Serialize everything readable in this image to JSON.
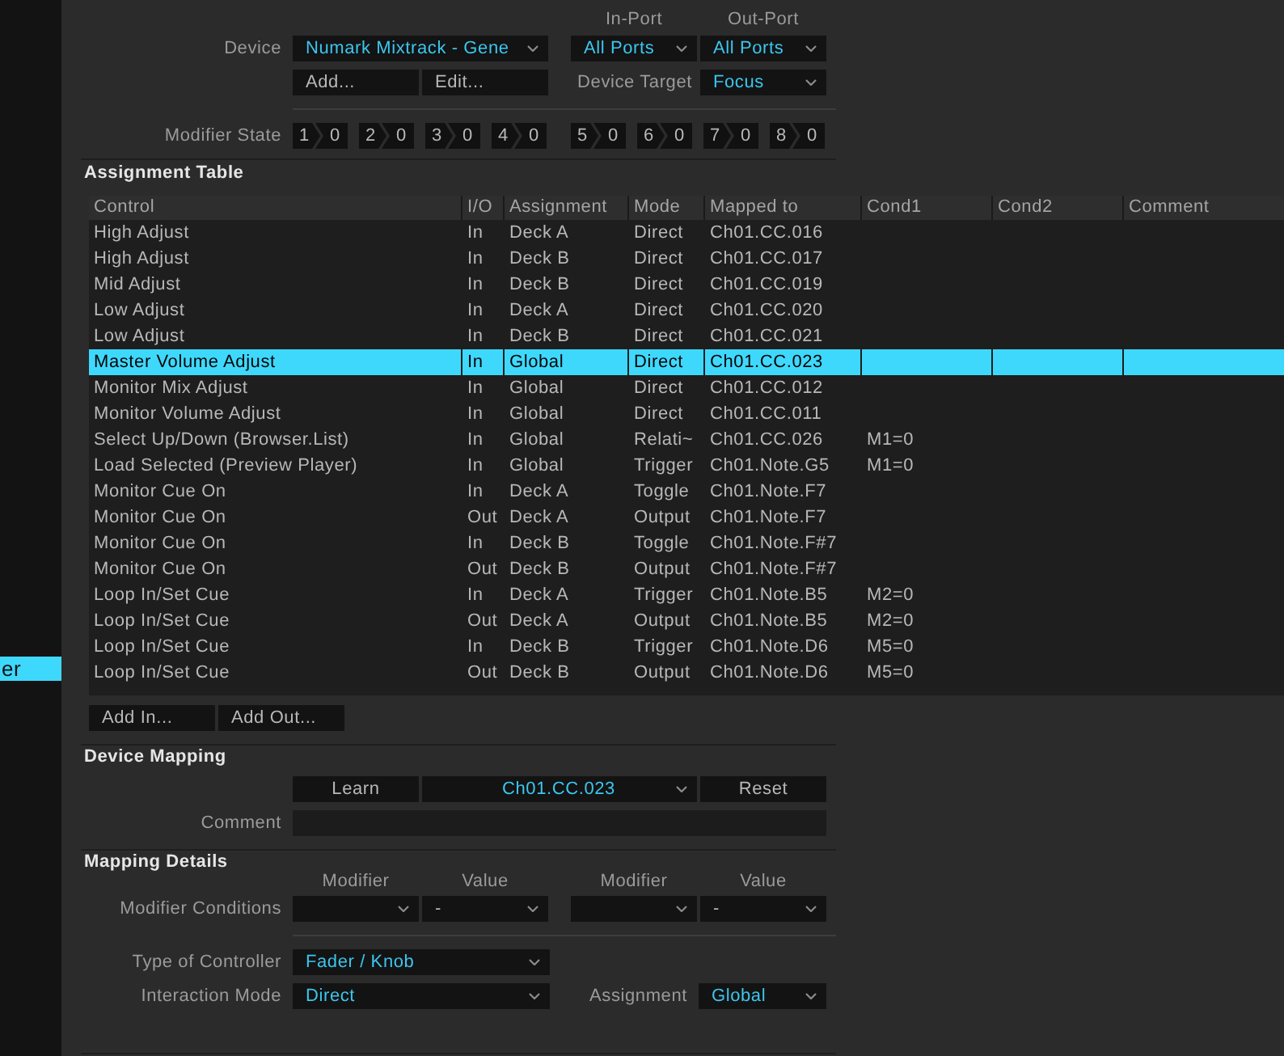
{
  "sidebar": {
    "items": [
      {
        "label": "er",
        "selected": true
      }
    ]
  },
  "device_setup": {
    "port_headers": [
      "In-Port",
      "Out-Port"
    ],
    "device": {
      "label": "Device",
      "value": "Numark Mixtrack - Gene"
    },
    "in_port": {
      "value": "All Ports"
    },
    "out_port": {
      "value": "All Ports"
    },
    "buttons": [
      "Add...",
      "Edit..."
    ],
    "device_target": {
      "label": "Device Target",
      "value": "Focus"
    },
    "modifier_state": {
      "label": "Modifier State",
      "modifiers": [
        {
          "number": "1",
          "value": "0"
        },
        {
          "number": "2",
          "value": "0"
        },
        {
          "number": "3",
          "value": "0"
        },
        {
          "number": "4",
          "value": "0"
        },
        {
          "number": "5",
          "value": "0"
        },
        {
          "number": "6",
          "value": "0"
        },
        {
          "number": "7",
          "value": "0"
        },
        {
          "number": "8",
          "value": "0"
        }
      ]
    }
  },
  "assignment_table": {
    "title": "Assignment Table",
    "columns": [
      "Control",
      "I/O",
      "Assignment",
      "Mode",
      "Mapped to",
      "Cond1",
      "Cond2",
      "Comment"
    ],
    "rows": [
      {
        "cells": [
          "High Adjust",
          "In",
          "Deck A",
          "Direct",
          "Ch01.CC.016"
        ],
        "selected": false
      },
      {
        "cells": [
          "High Adjust",
          "In",
          "Deck B",
          "Direct",
          "Ch01.CC.017"
        ],
        "selected": false
      },
      {
        "cells": [
          "Mid Adjust",
          "In",
          "Deck B",
          "Direct",
          "Ch01.CC.019"
        ],
        "selected": false
      },
      {
        "cells": [
          "Low Adjust",
          "In",
          "Deck A",
          "Direct",
          "Ch01.CC.020"
        ],
        "selected": false
      },
      {
        "cells": [
          "Low Adjust",
          "In",
          "Deck B",
          "Direct",
          "Ch01.CC.021"
        ],
        "selected": false
      },
      {
        "cells": [
          "Master Volume Adjust",
          "In",
          "Global",
          "Direct",
          "Ch01.CC.023"
        ],
        "selected": true
      },
      {
        "cells": [
          "Monitor Mix Adjust",
          "In",
          "Global",
          "Direct",
          "Ch01.CC.012"
        ],
        "selected": false
      },
      {
        "cells": [
          "Monitor Volume Adjust",
          "In",
          "Global",
          "Direct",
          "Ch01.CC.011"
        ],
        "selected": false
      },
      {
        "cells": [
          "Select Up/Down (Browser.List)",
          "In",
          "Global",
          "Relati~",
          "Ch01.CC.026",
          "M1=0"
        ],
        "selected": false
      },
      {
        "cells": [
          "Load Selected (Preview Player)",
          "In",
          "Global",
          "Trigger",
          "Ch01.Note.G5",
          "M1=0"
        ],
        "selected": false
      },
      {
        "cells": [
          "Monitor Cue On",
          "In",
          "Deck A",
          "Toggle",
          "Ch01.Note.F7"
        ],
        "selected": false
      },
      {
        "cells": [
          "Monitor Cue On",
          "Out",
          "Deck A",
          "Output",
          "Ch01.Note.F7"
        ],
        "selected": false
      },
      {
        "cells": [
          "Monitor Cue On",
          "In",
          "Deck B",
          "Toggle",
          "Ch01.Note.F#7"
        ],
        "selected": false
      },
      {
        "cells": [
          "Monitor Cue On",
          "Out",
          "Deck B",
          "Output",
          "Ch01.Note.F#7"
        ],
        "selected": false
      },
      {
        "cells": [
          "Loop In/Set Cue",
          "In",
          "Deck A",
          "Trigger",
          "Ch01.Note.B5",
          "M2=0"
        ],
        "selected": false
      },
      {
        "cells": [
          "Loop In/Set Cue",
          "Out",
          "Deck A",
          "Output",
          "Ch01.Note.B5",
          "M2=0"
        ],
        "selected": false
      },
      {
        "cells": [
          "Loop In/Set Cue",
          "In",
          "Deck B",
          "Trigger",
          "Ch01.Note.D6",
          "M5=0"
        ],
        "selected": false
      },
      {
        "cells": [
          "Loop In/Set Cue",
          "Out",
          "Deck B",
          "Output",
          "Ch01.Note.D6",
          "M5=0"
        ],
        "selected": false
      }
    ],
    "buttons": [
      "Add In...",
      "Add Out..."
    ]
  },
  "device_mapping": {
    "title": "Device Mapping",
    "learn_button": "Learn",
    "mapping": {
      "value": "Ch01.CC.023"
    },
    "reset_button": "Reset",
    "comment": {
      "label": "Comment"
    }
  },
  "mapping_details": {
    "title": "Mapping Details",
    "condition_headers": [
      "Modifier",
      "Value",
      "Modifier",
      "Value"
    ],
    "modifier_conditions": {
      "label": "Modifier Conditions",
      "conditions": [
        {
          "value": "-"
        },
        {
          "value": "-"
        }
      ]
    },
    "type_of_controller": {
      "label": "Type of Controller",
      "value": "Fader / Knob"
    },
    "interaction_mode": {
      "label": "Interaction Mode",
      "value": "Direct"
    },
    "assignment": {
      "label": "Assignment",
      "value": "Global"
    }
  }
}
